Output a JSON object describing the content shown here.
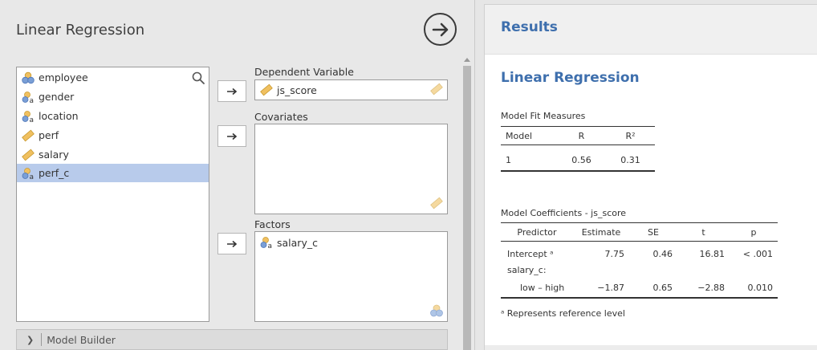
{
  "analysis": {
    "title": "Linear Regression",
    "run_icon": "arrow-right-circle-icon"
  },
  "variables": [
    {
      "name": "employee",
      "icon": "nominal-icon",
      "selected": false
    },
    {
      "name": "gender",
      "icon": "nominal-text-icon",
      "selected": false
    },
    {
      "name": "location",
      "icon": "nominal-text-icon",
      "selected": false
    },
    {
      "name": "perf",
      "icon": "continuous-icon",
      "selected": false
    },
    {
      "name": "salary",
      "icon": "continuous-icon",
      "selected": false
    },
    {
      "name": "perf_c",
      "icon": "nominal-text-icon",
      "selected": true
    }
  ],
  "dependent": {
    "label": "Dependent Variable",
    "value": "js_score"
  },
  "covariates": {
    "label": "Covariates",
    "items": []
  },
  "factors": {
    "label": "Factors",
    "items": [
      "salary_c"
    ]
  },
  "model_builder": {
    "label": "Model Builder"
  },
  "results": {
    "header": "Results",
    "heading": "Linear Regression",
    "fit": {
      "title": "Model Fit Measures",
      "columns": [
        "Model",
        "R",
        "R²"
      ],
      "rows": [
        [
          "1",
          "0.56",
          "0.31"
        ]
      ]
    },
    "coef": {
      "title": "Model Coefficients - js_score",
      "columns": [
        "Predictor",
        "Estimate",
        "SE",
        "t",
        "p"
      ],
      "rows": [
        [
          "Intercept ᵃ",
          "7.75",
          "0.46",
          "16.81",
          "< .001"
        ],
        [
          "salary_c:",
          "",
          "",
          "",
          ""
        ],
        [
          "low – high",
          "−1.87",
          "0.65",
          "−2.88",
          "0.010"
        ]
      ]
    },
    "footnote": "ᵃ Represents reference level"
  },
  "colors": {
    "accent": "#3e6fad",
    "selected_row": "#b8cbeb",
    "continuous": "#f0c060",
    "nominal": "#7a9fd6"
  }
}
